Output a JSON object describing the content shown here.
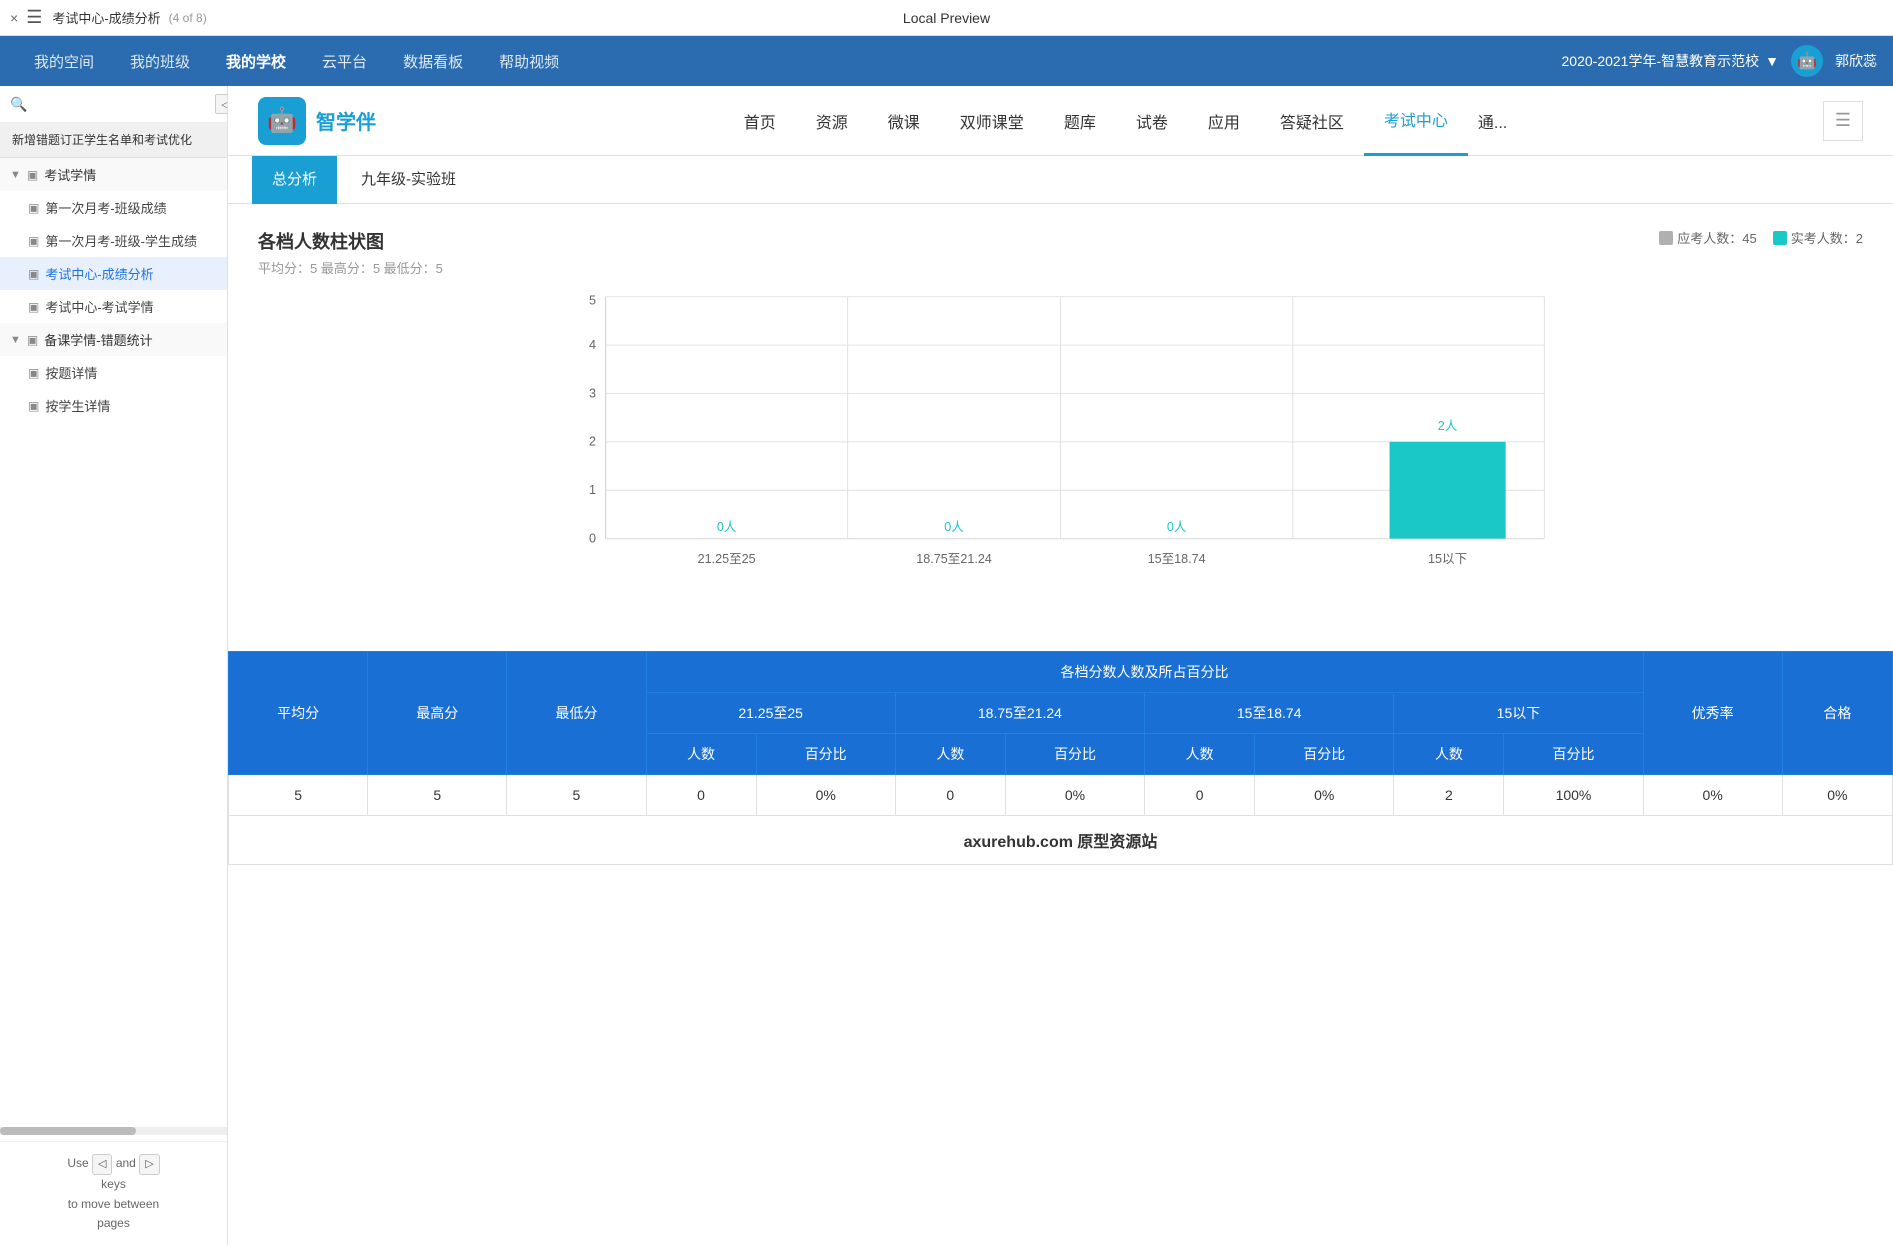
{
  "window": {
    "close_label": "×",
    "menu_icon": "☰",
    "title": "考试中心-成绩分析",
    "page_info": "(4 of 8)",
    "center_title": "Local Preview"
  },
  "navbar": {
    "items": [
      {
        "label": "我的空间",
        "active": false
      },
      {
        "label": "我的班级",
        "active": false
      },
      {
        "label": "我的学校",
        "active": true
      },
      {
        "label": "云平台",
        "active": false
      },
      {
        "label": "数据看板",
        "active": false
      },
      {
        "label": "帮助视频",
        "active": false
      }
    ],
    "year_label": "2020-2021学年-智慧教育示范校",
    "user_name": "郭欣蕊",
    "chevron": "▼"
  },
  "sidebar": {
    "search_placeholder": "",
    "promo_text": "新增错题订正学生名单和考试优化",
    "groups": [
      {
        "label": "考试学情",
        "expanded": true,
        "items": [
          {
            "label": "第一次月考-班级成绩",
            "active": false
          },
          {
            "label": "第一次月考-班级-学生成绩",
            "active": false
          },
          {
            "label": "考试中心-成绩分析",
            "active": true
          },
          {
            "label": "考试中心-考试学情",
            "active": false
          }
        ]
      },
      {
        "label": "备课学情-错题统计",
        "expanded": true,
        "items": [
          {
            "label": "按题详情",
            "active": false
          },
          {
            "label": "按学生详情",
            "active": false
          }
        ]
      }
    ],
    "nav_hint_use": "Use",
    "nav_hint_and": "and",
    "nav_hint_keys": "keys",
    "nav_hint_move": "to move between",
    "nav_hint_pages": "pages",
    "prev_key": "◁",
    "next_key": "▷"
  },
  "brand": {
    "logo_icon": "🤖",
    "logo_text": "智学伴",
    "nav_items": [
      {
        "label": "首页",
        "active": false
      },
      {
        "label": "资源",
        "active": false
      },
      {
        "label": "微课",
        "active": false
      },
      {
        "label": "双师课堂",
        "active": false
      },
      {
        "label": "题库",
        "active": false
      },
      {
        "label": "试卷",
        "active": false
      },
      {
        "label": "应用",
        "active": false
      },
      {
        "label": "答疑社区",
        "active": false
      },
      {
        "label": "考试中心",
        "active": true
      },
      {
        "label": "通...",
        "active": false
      }
    ]
  },
  "tabs": [
    {
      "label": "总分析",
      "active": true
    },
    {
      "label": "九年级-实验班",
      "active": false
    }
  ],
  "chart": {
    "title": "各档人数柱状图",
    "subtitle": "平均分：5  最高分：5  最低分：5",
    "legend_expected_label": "应考人数：45",
    "legend_actual_label": "实考人数：2",
    "legend_expected_color": "#b0b0b0",
    "legend_actual_color": "#1ac8c8",
    "y_axis": [
      0,
      1,
      2,
      3,
      4,
      5
    ],
    "bars": [
      {
        "range": "21.25至25",
        "count": 0,
        "label": "0人",
        "x": 17
      },
      {
        "range": "18.75至21.24",
        "count": 0,
        "label": "0人",
        "x": 42
      },
      {
        "range": "15至18.74",
        "count": 0,
        "label": "0人",
        "x": 67
      },
      {
        "range": "15以下",
        "count": 2,
        "label": "2人",
        "x": 82
      }
    ]
  },
  "table": {
    "col_avg": "平均分",
    "col_max": "最高分",
    "col_min": "最低分",
    "col_range_title": "各档分数人数及所占百分比",
    "ranges": [
      {
        "label": "21.25至25"
      },
      {
        "label": "18.75至21.24"
      },
      {
        "label": "15至18.74"
      },
      {
        "label": "15以下"
      }
    ],
    "sub_cols": [
      "人数",
      "百分比"
    ],
    "col_excellence": "优秀率",
    "col_pass": "合格",
    "row": {
      "avg": "5",
      "max": "5",
      "min": "5",
      "r1_count": "0",
      "r1_pct": "0%",
      "r2_count": "0",
      "r2_pct": "0%",
      "r3_count": "0",
      "r3_pct": "0%",
      "r4_count": "2",
      "r4_pct": "100%",
      "excellence": "0%",
      "pass": "0%"
    },
    "watermark": "axurehub.com 原型资源站"
  }
}
